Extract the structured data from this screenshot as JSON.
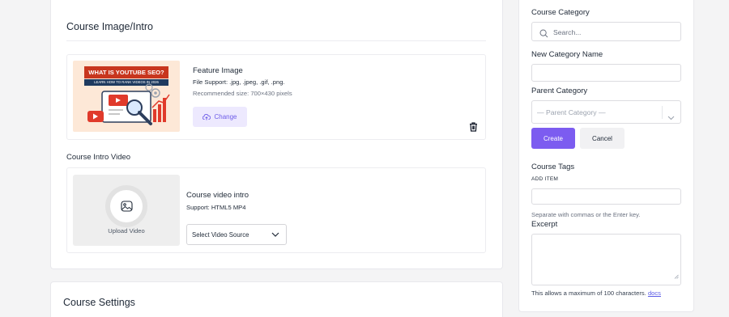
{
  "intro_card": {
    "title": "Course Image/Intro",
    "feature_image": {
      "label": "Feature Image",
      "file_support": "File Support: .jpg, .jpeg, .gif, .png.",
      "recommended_size": "Recommended size: 700×430 pixels",
      "change_label": "Change",
      "thumbnail_title": "WHAT IS YOUTUBE SEO?",
      "thumbnail_subtitle": "LEARN HOW TO RANK VIDEOS IN 2026"
    },
    "intro_video": {
      "section_title": "Course Intro Video",
      "upload_label": "Upload Video",
      "title": "Course video intro",
      "support": "Support: HTML5 MP4",
      "source_select": "Select Video Source"
    }
  },
  "settings_card": {
    "title": "Course Settings"
  },
  "sidebar": {
    "category": {
      "title": "Course Category",
      "search_placeholder": "Search..."
    },
    "new_category": {
      "title": "New Category Name",
      "value": ""
    },
    "parent_category": {
      "title": "Parent Category",
      "selected": "— Parent Category —"
    },
    "create_label": "Create",
    "cancel_label": "Cancel",
    "tags": {
      "title": "Course Tags",
      "add_item": "ADD ITEM",
      "value": "",
      "hint": "Separate with commas or the Enter key."
    },
    "excerpt": {
      "title": "Excerpt",
      "value": "",
      "hint": "This allows a maximum of 100 characters.",
      "docs_link": "docs"
    }
  },
  "colors": {
    "accent": "#7c5cf0",
    "accent_light": "#ede9fe",
    "thumbnail_banner": "#c8361e"
  }
}
